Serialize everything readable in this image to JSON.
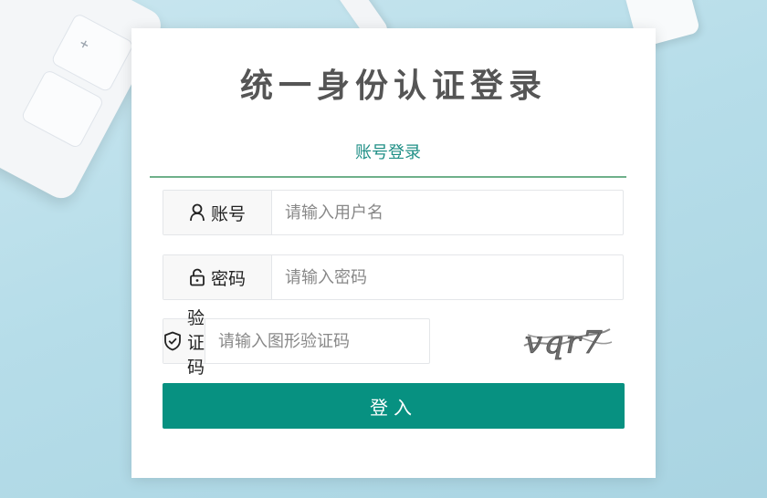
{
  "page": {
    "title": "统一身份认证登录"
  },
  "tabs": [
    {
      "label": "账号登录",
      "active": true
    }
  ],
  "form": {
    "account": {
      "label": "账号",
      "placeholder": "请输入用户名",
      "icon": "user-icon"
    },
    "password": {
      "label": "密码",
      "placeholder": "请输入密码",
      "icon": "lock-icon"
    },
    "captcha": {
      "label": "验证码",
      "placeholder": "请输入图形验证码",
      "icon": "shield-check-icon",
      "image_text": "vqr7"
    }
  },
  "login_button": {
    "label": "登入"
  },
  "colors": {
    "accent": "#079181",
    "tab_text": "#1f8f86",
    "tab_underline": "#6fb08a",
    "title": "#555555"
  }
}
